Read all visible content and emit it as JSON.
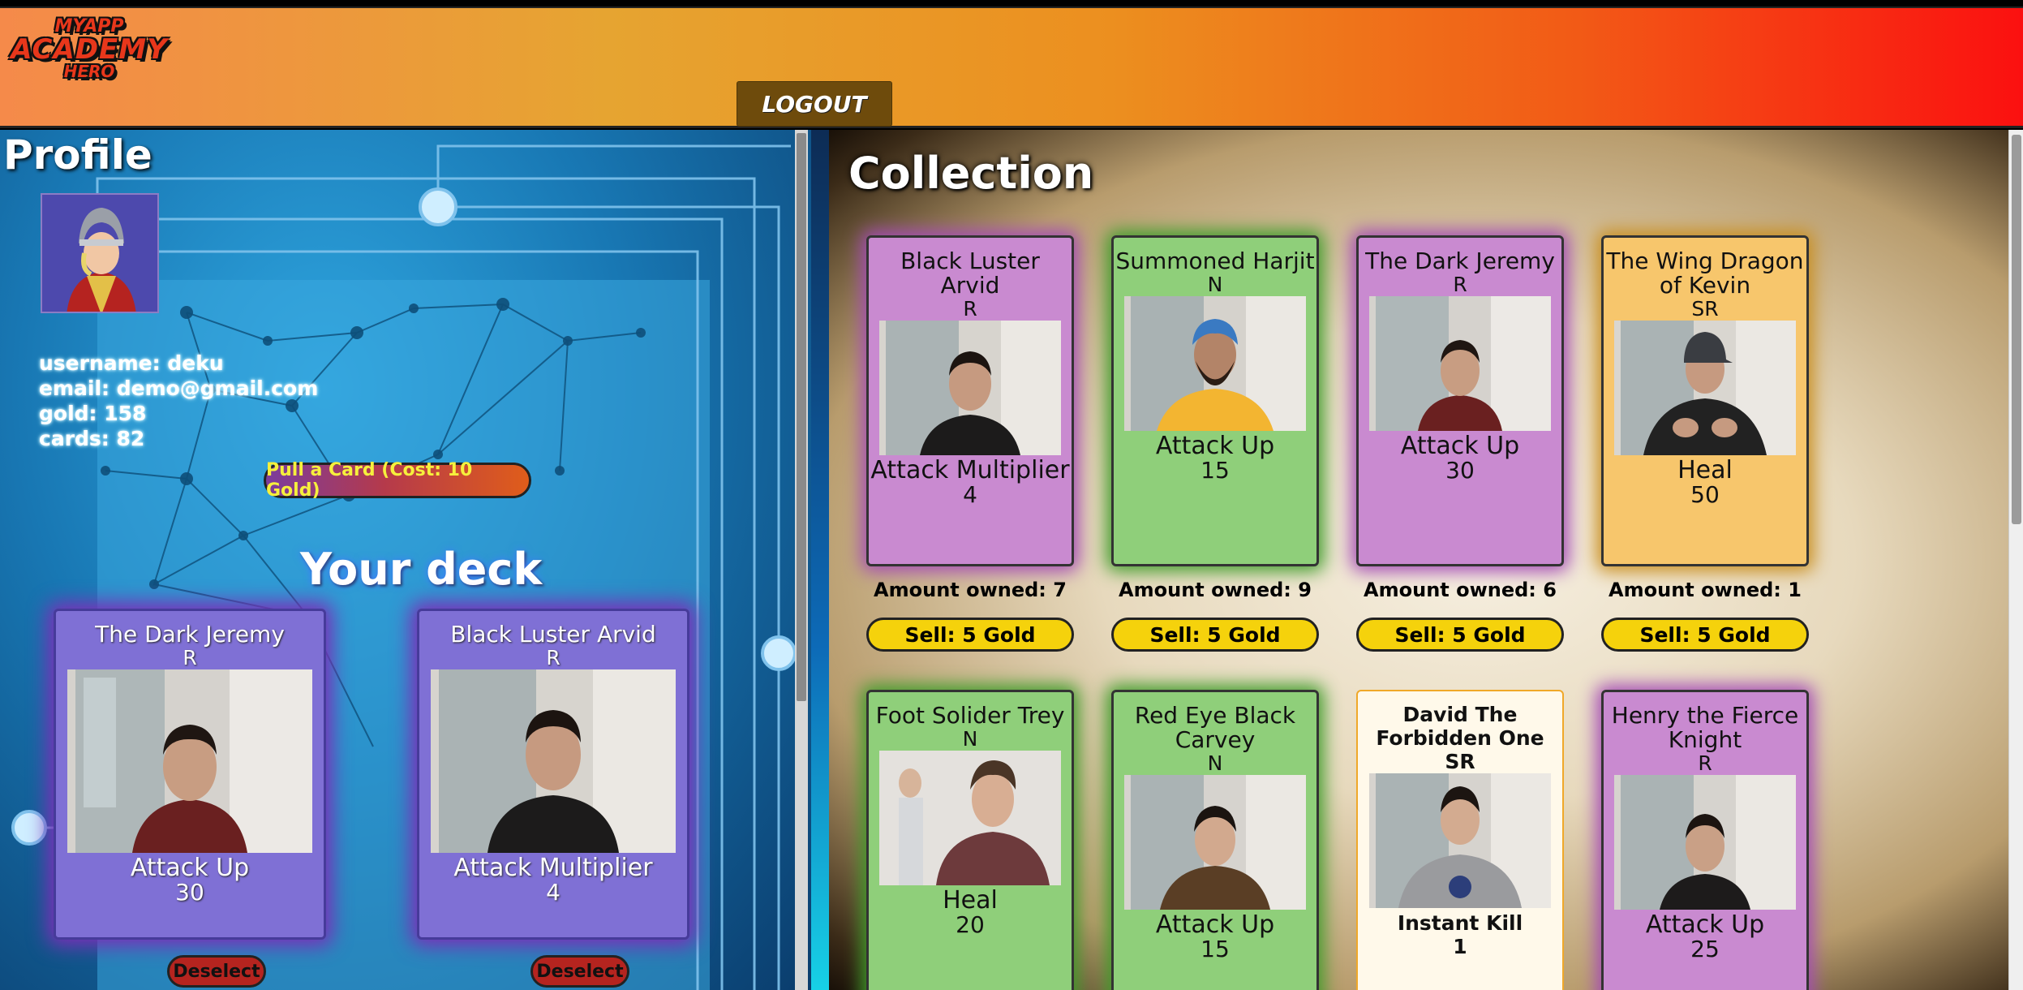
{
  "header": {
    "logo_line1": "MYAPP",
    "logo_line2": "ACADEMY",
    "logo_line3": "HERO",
    "logout_label": "LOGOUT"
  },
  "profile": {
    "title": "Profile",
    "username": "username: deku",
    "email": "email: demo@gmail.com",
    "gold": "gold: 158",
    "cards": "cards: 82",
    "pull_button": "Pull a Card (Cost: 10 Gold)",
    "deck_title": "Your deck",
    "deck": [
      {
        "name": "The Dark Jeremy",
        "rarity": "R",
        "effect": "Attack Up",
        "value": "30",
        "button": "Deselect"
      },
      {
        "name": "Black Luster Arvid",
        "rarity": "R",
        "effect": "Attack Multiplier",
        "value": "4",
        "button": "Deselect"
      }
    ]
  },
  "collection": {
    "title": "Collection",
    "cards": [
      {
        "name": "Black Luster Arvid",
        "rarity": "R",
        "effect": "Attack Multiplier",
        "value": "4",
        "owned": "Amount owned: 7",
        "sell": "Sell: 5 Gold"
      },
      {
        "name": "Summoned Harjit",
        "rarity": "N",
        "effect": "Attack Up",
        "value": "15",
        "owned": "Amount owned: 9",
        "sell": "Sell: 5 Gold"
      },
      {
        "name": "The Dark Jeremy",
        "rarity": "R",
        "effect": "Attack Up",
        "value": "30",
        "owned": "Amount owned: 6",
        "sell": "Sell: 5 Gold"
      },
      {
        "name": "The Wing Dragon of Kevin",
        "rarity": "SR",
        "effect": "Heal",
        "value": "50",
        "owned": "Amount owned: 1",
        "sell": "Sell: 5 Gold"
      },
      {
        "name": "Foot Solider Trey",
        "rarity": "N",
        "effect": "Heal",
        "value": "20"
      },
      {
        "name": "Red Eye Black Carvey",
        "rarity": "N",
        "effect": "Attack Up",
        "value": "15"
      },
      {
        "name": "David The Forbidden One",
        "rarity": "SR",
        "effect": "Instant Kill",
        "value": "1"
      },
      {
        "name": "Henry the Fierce Knight",
        "rarity": "R",
        "effect": "Attack Up",
        "value": "25"
      }
    ]
  },
  "colors": {
    "rarity_r": "#c98ad0",
    "rarity_n": "#8fcf7a",
    "rarity_sr": "#f7c66c",
    "deck_card": "#7f70d5",
    "sell_button": "#f5d20c",
    "deselect_button": "#b5241f"
  }
}
